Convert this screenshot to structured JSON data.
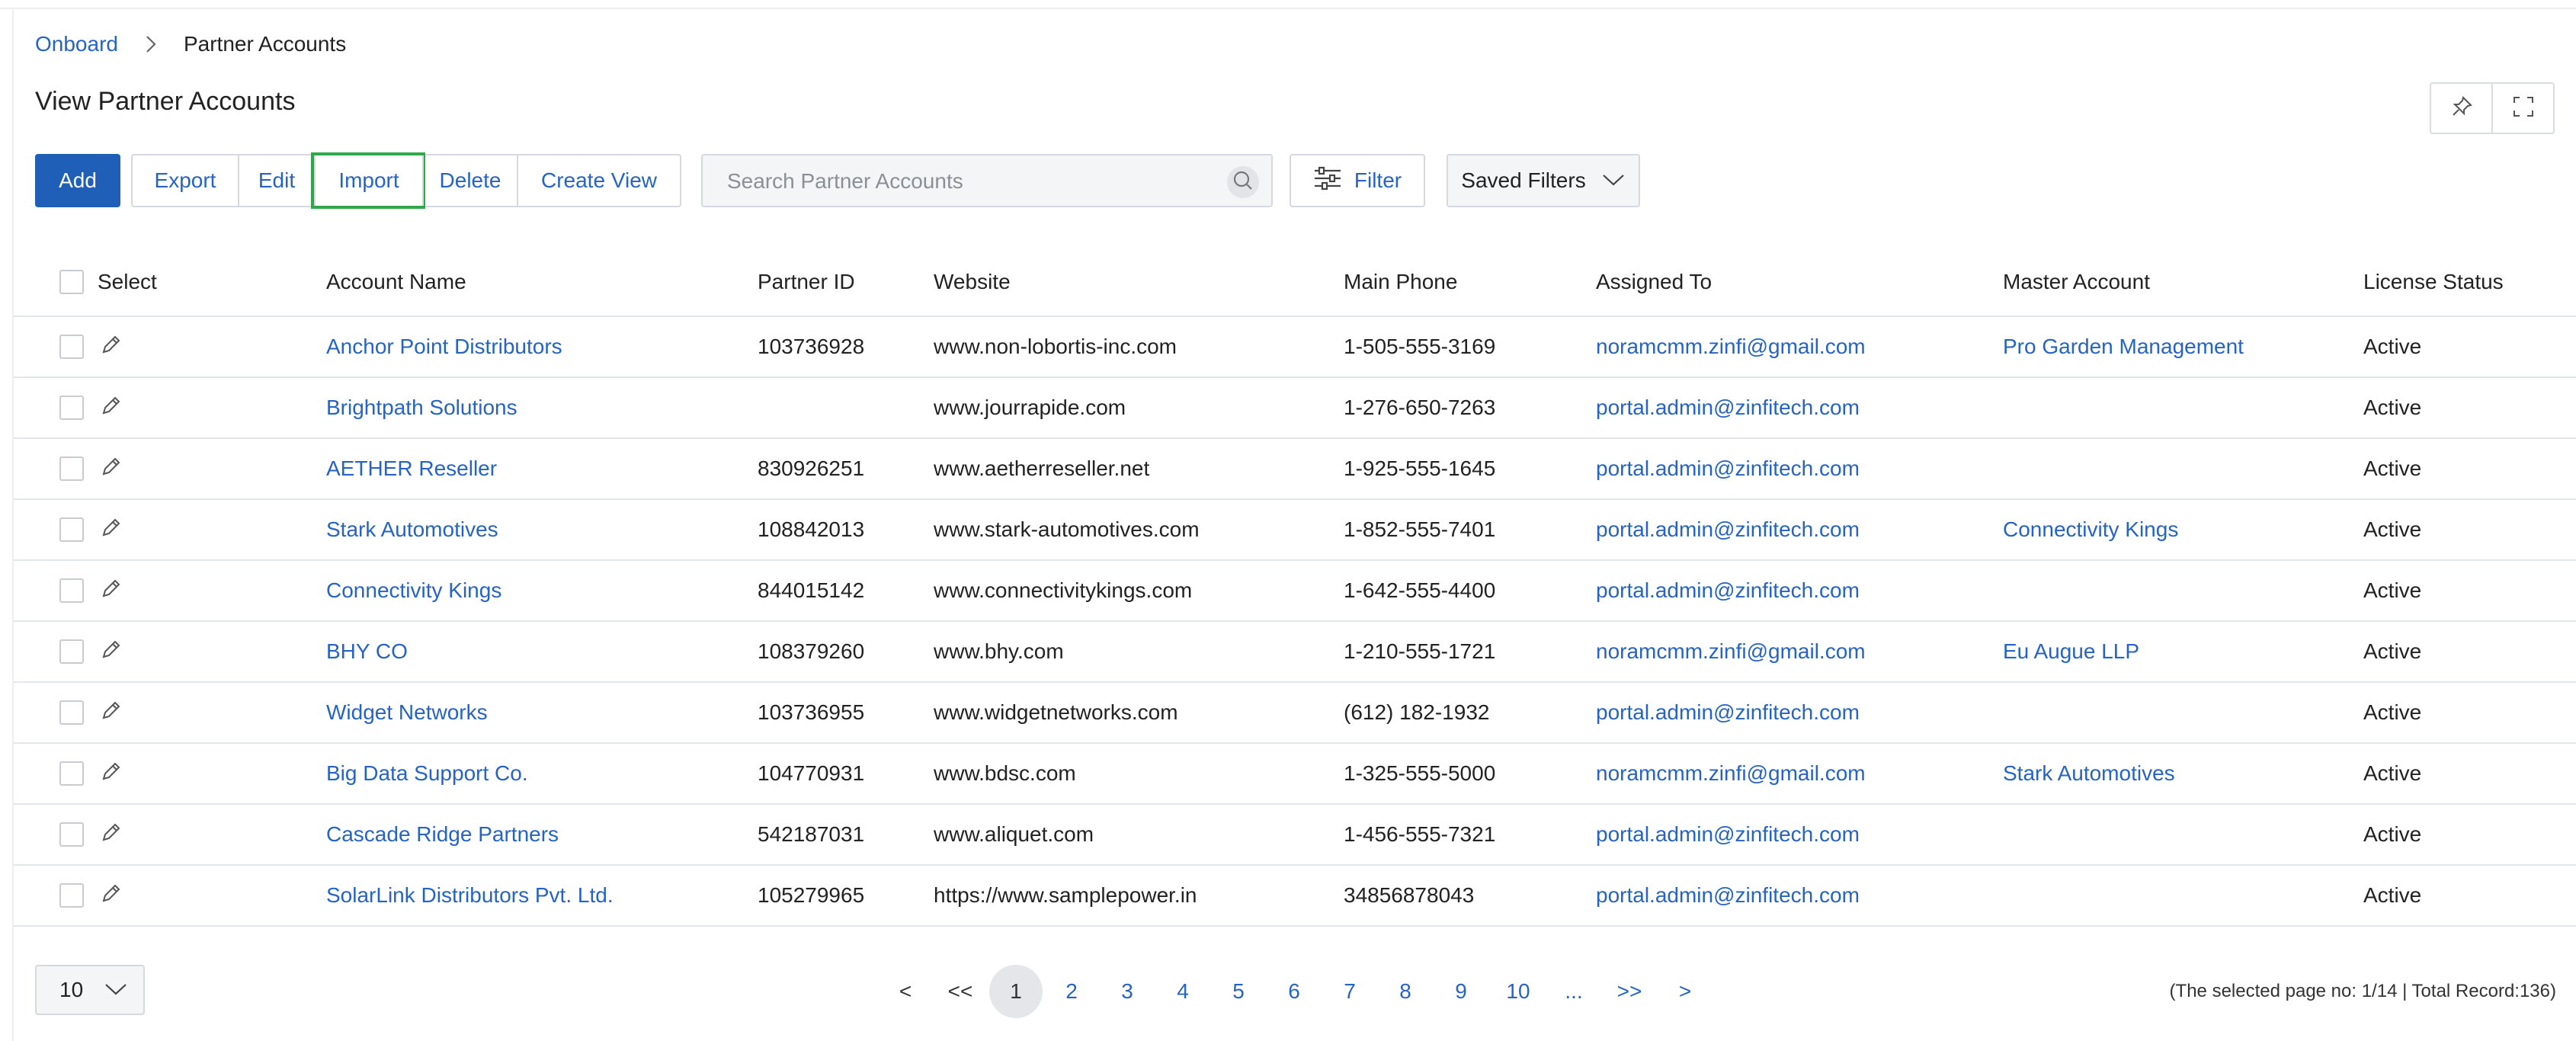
{
  "breadcrumb": {
    "root": "Onboard",
    "current": "Partner Accounts"
  },
  "page": {
    "title": "View Partner Accounts"
  },
  "toolbar": {
    "add": "Add",
    "export": "Export",
    "edit": "Edit",
    "import": "Import",
    "delete": "Delete",
    "create_view": "Create View",
    "search_placeholder": "Search Partner Accounts",
    "filter": "Filter",
    "saved_filters": "Saved Filters"
  },
  "table": {
    "headers": {
      "select": "Select",
      "account_name": "Account Name",
      "partner_id": "Partner ID",
      "website": "Website",
      "main_phone": "Main Phone",
      "assigned_to": "Assigned To",
      "master_account": "Master Account",
      "license_status": "License Status"
    },
    "rows": [
      {
        "account_name": "Anchor Point Distributors",
        "partner_id": "103736928",
        "website": "www.non-lobortis-inc.com",
        "main_phone": "1-505-555-3169",
        "assigned_to": "noramcmm.zinfi@gmail.com",
        "master_account": "Pro Garden Management",
        "license_status": "Active"
      },
      {
        "account_name": "Brightpath Solutions",
        "partner_id": "",
        "website": "www.jourrapide.com",
        "main_phone": "1-276-650-7263",
        "assigned_to": "portal.admin@zinfitech.com",
        "master_account": "",
        "license_status": "Active"
      },
      {
        "account_name": "AETHER Reseller",
        "partner_id": "830926251",
        "website": "www.aetherreseller.net",
        "main_phone": "1-925-555-1645",
        "assigned_to": "portal.admin@zinfitech.com",
        "master_account": "",
        "license_status": "Active"
      },
      {
        "account_name": "Stark Automotives",
        "partner_id": "108842013",
        "website": "www.stark-automotives.com",
        "main_phone": "1-852-555-7401",
        "assigned_to": "portal.admin@zinfitech.com",
        "master_account": "Connectivity Kings",
        "license_status": "Active"
      },
      {
        "account_name": "Connectivity Kings",
        "partner_id": "844015142",
        "website": "www.connectivitykings.com",
        "main_phone": "1-642-555-4400",
        "assigned_to": "portal.admin@zinfitech.com",
        "master_account": "",
        "license_status": "Active"
      },
      {
        "account_name": "BHY CO",
        "partner_id": "108379260",
        "website": "www.bhy.com",
        "main_phone": "1-210-555-1721",
        "assigned_to": "noramcmm.zinfi@gmail.com",
        "master_account": "Eu Augue LLP",
        "license_status": "Active"
      },
      {
        "account_name": "Widget Networks",
        "partner_id": "103736955",
        "website": "www.widgetnetworks.com",
        "main_phone": "(612) 182-1932",
        "assigned_to": "portal.admin@zinfitech.com",
        "master_account": "",
        "license_status": "Active"
      },
      {
        "account_name": "Big Data Support Co.",
        "partner_id": "104770931",
        "website": "www.bdsc.com",
        "main_phone": "1-325-555-5000",
        "assigned_to": "noramcmm.zinfi@gmail.com",
        "master_account": "Stark Automotives",
        "license_status": "Active"
      },
      {
        "account_name": "Cascade Ridge Partners",
        "partner_id": "542187031",
        "website": "www.aliquet.com",
        "main_phone": "1-456-555-7321",
        "assigned_to": "portal.admin@zinfitech.com",
        "master_account": "",
        "license_status": "Active"
      },
      {
        "account_name": "SolarLink Distributors Pvt. Ltd.",
        "partner_id": "105279965",
        "website": "https://www.samplepower.in",
        "main_phone": "34856878043",
        "assigned_to": "portal.admin@zinfitech.com",
        "master_account": "",
        "license_status": "Active"
      }
    ]
  },
  "pagination": {
    "page_size": "10",
    "prev": "<",
    "first": "<<",
    "next_block": ">>",
    "next": ">",
    "pages": [
      "1",
      "2",
      "3",
      "4",
      "5",
      "6",
      "7",
      "8",
      "9",
      "10"
    ],
    "ellipsis": "...",
    "current_page": "1",
    "summary": "(The selected page no: 1/14 | Total Record:136)"
  },
  "colors": {
    "primary": "#1f5fb8",
    "link": "#2563c7",
    "highlight": "#2ea84a"
  },
  "icons": [
    "chevron-right-icon",
    "pin-icon",
    "fullscreen-icon",
    "search-icon",
    "filter-sliders-icon",
    "chevron-down-icon",
    "pencil-icon"
  ]
}
